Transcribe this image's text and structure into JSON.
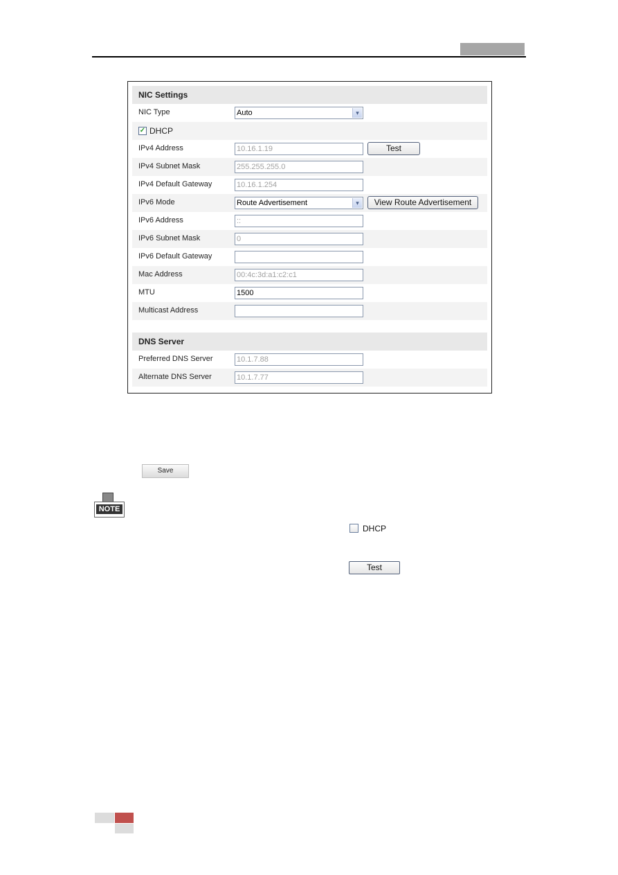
{
  "nic_settings": {
    "title": "NIC Settings",
    "nic_type": {
      "label": "NIC Type",
      "value": "Auto"
    },
    "dhcp": {
      "label": "DHCP",
      "checked": true,
      "mark": "✓"
    },
    "ipv4_address": {
      "label": "IPv4 Address",
      "value": "10.16.1.19",
      "button": "Test"
    },
    "ipv4_subnet_mask": {
      "label": "IPv4 Subnet Mask",
      "value": "255.255.255.0"
    },
    "ipv4_default_gateway": {
      "label": "IPv4 Default Gateway",
      "value": "10.16.1.254"
    },
    "ipv6_mode": {
      "label": "IPv6 Mode",
      "value": "Route Advertisement",
      "button": "View Route Advertisement"
    },
    "ipv6_address": {
      "label": "IPv6 Address",
      "value": "::"
    },
    "ipv6_subnet_mask": {
      "label": "IPv6 Subnet Mask",
      "value": "0"
    },
    "ipv6_default_gateway": {
      "label": "IPv6 Default Gateway",
      "value": ""
    },
    "mac_address": {
      "label": "Mac Address",
      "value": "00:4c:3d:a1:c2:c1"
    },
    "mtu": {
      "label": "MTU",
      "value": "1500"
    },
    "multicast_address": {
      "label": "Multicast Address",
      "value": ""
    }
  },
  "dns_server": {
    "title": "DNS Server",
    "preferred": {
      "label": "Preferred DNS Server",
      "value": "10.1.7.88"
    },
    "alternate": {
      "label": "Alternate DNS Server",
      "value": "10.1.7.77"
    }
  },
  "body": {
    "save_label": "Save",
    "note_label": "NOTE",
    "dhcp_inline_label": "DHCP",
    "test_inline_label": "Test"
  },
  "icons": {
    "dropdown": "▾"
  }
}
